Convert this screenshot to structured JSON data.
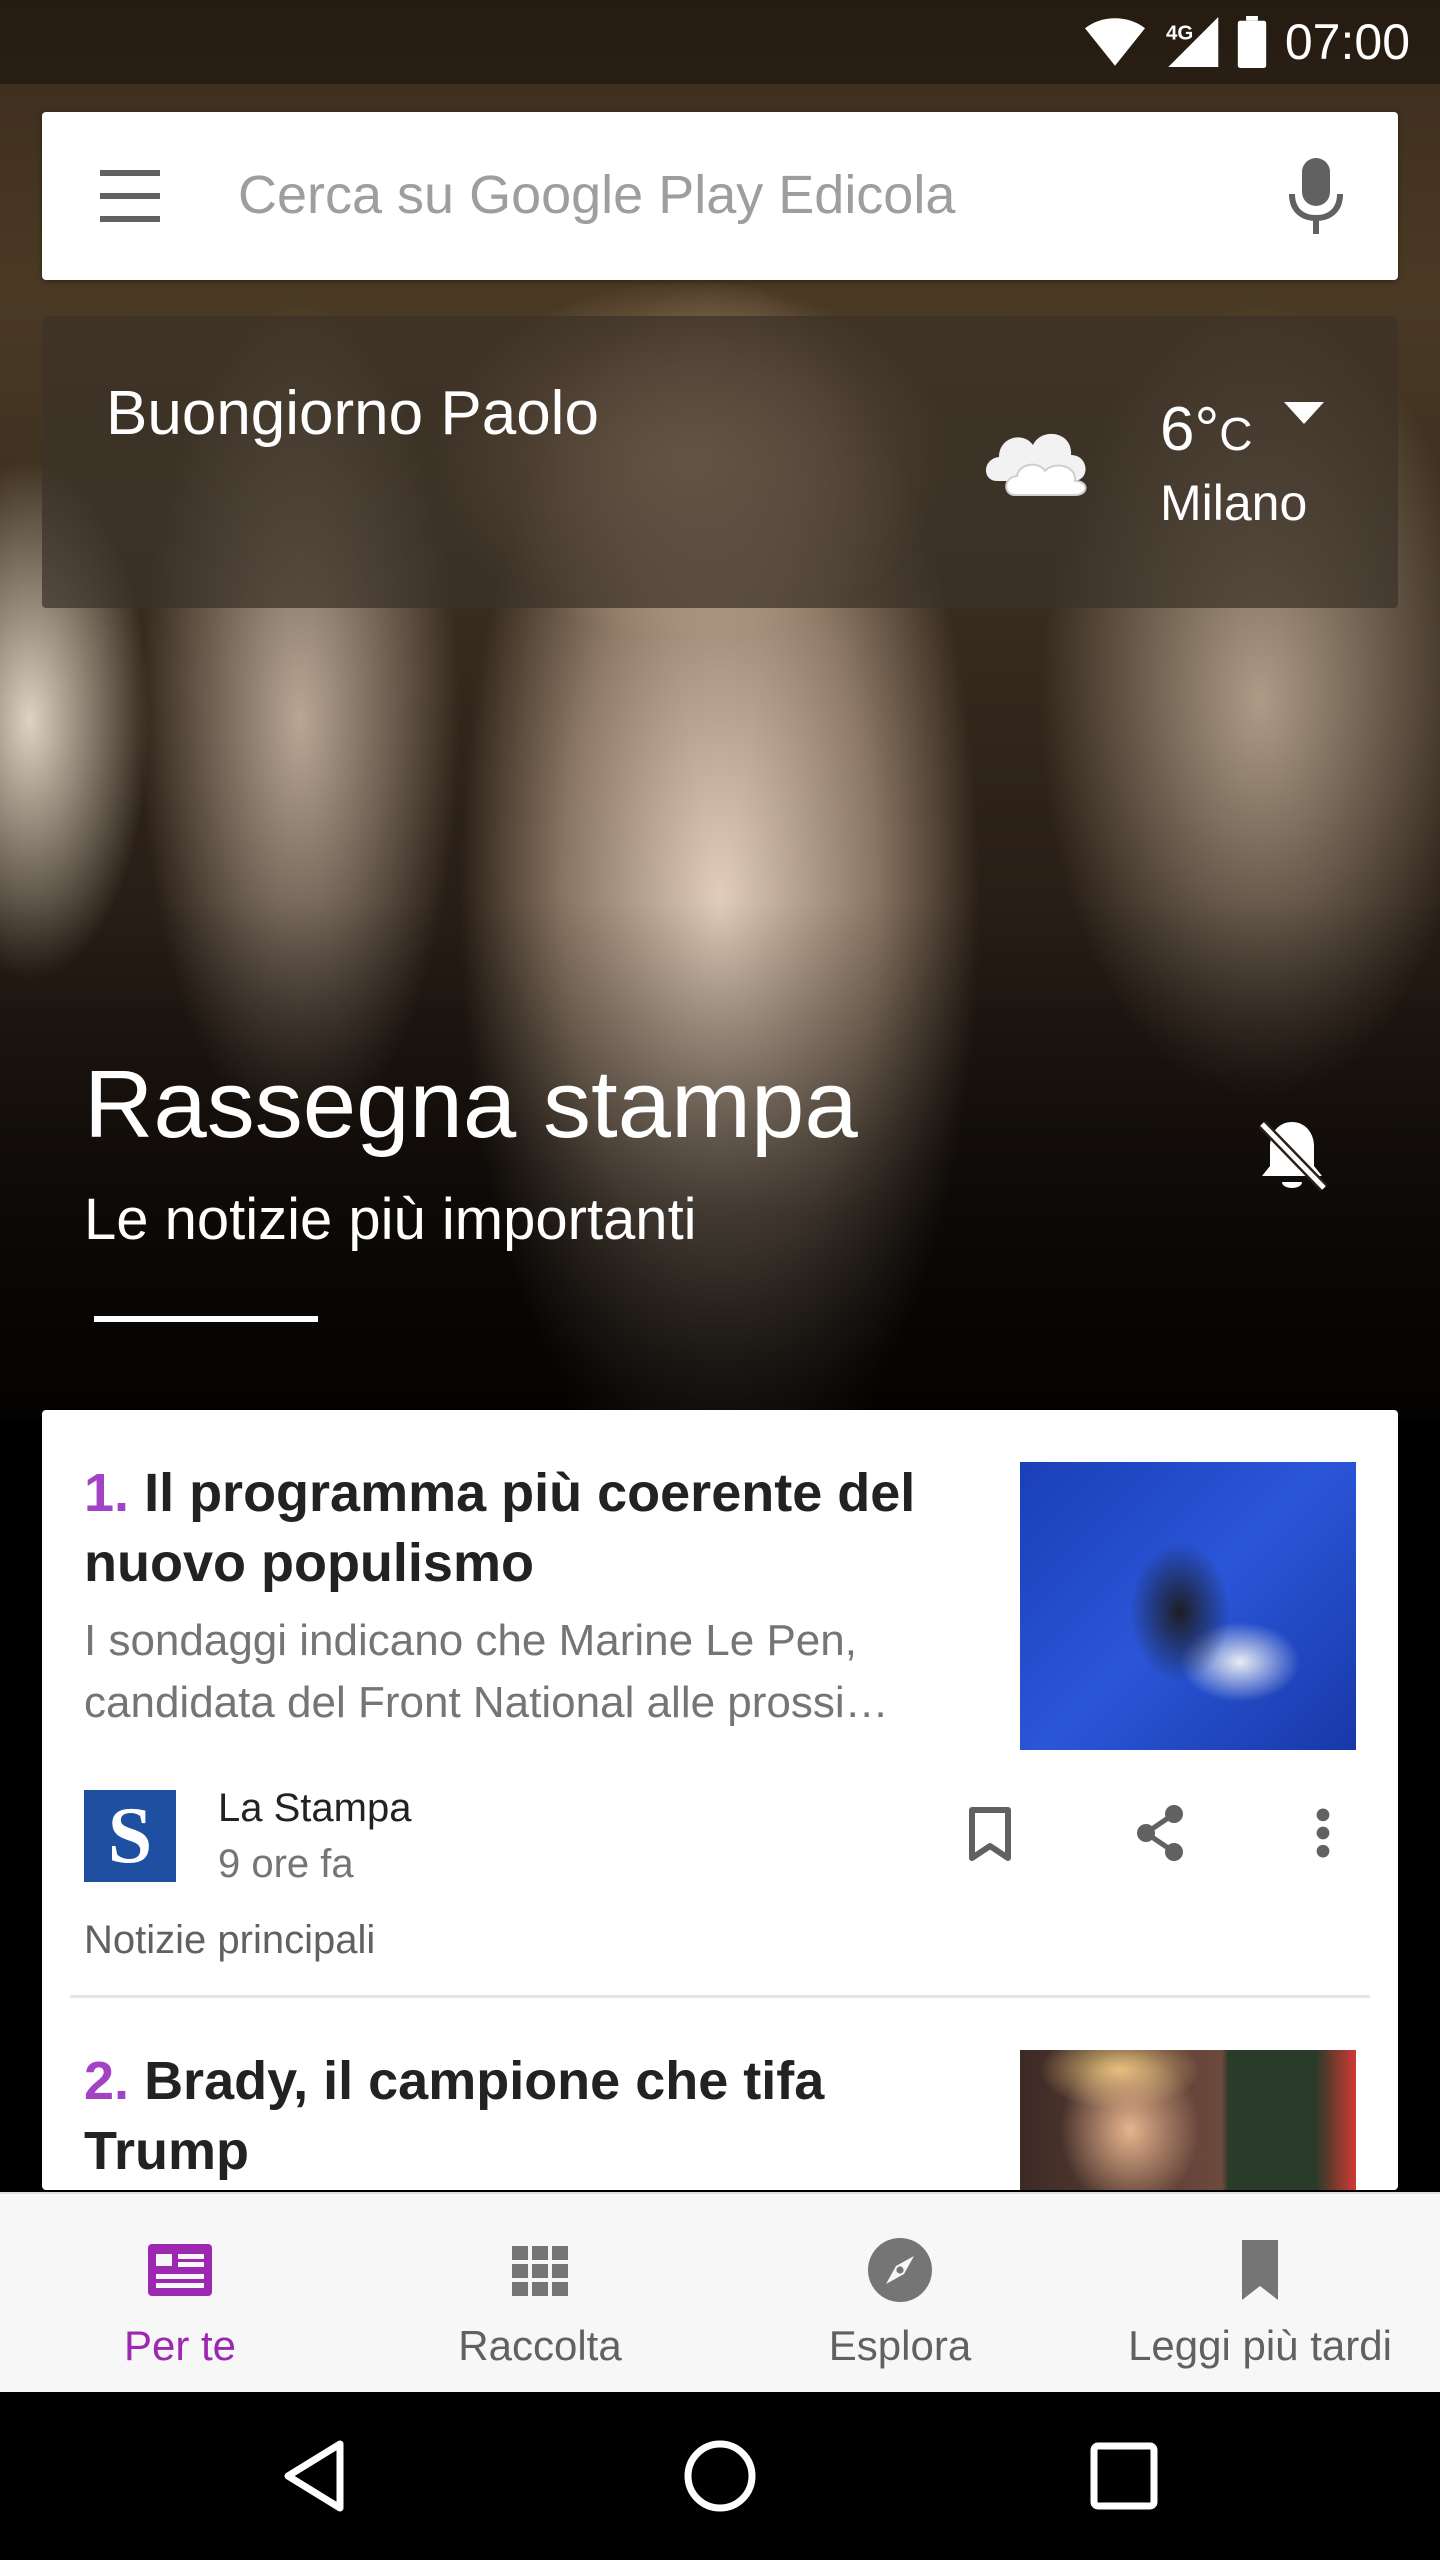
{
  "status_bar": {
    "network": "4G",
    "time": "07:00"
  },
  "search": {
    "placeholder": "Cerca su Google Play Edicola",
    "menu_icon": "menu-icon",
    "mic_icon": "mic-icon"
  },
  "greeting": {
    "text": "Buongiorno Paolo",
    "weather_icon": "cloud-icon",
    "temperature": "6°",
    "unit": "C",
    "city": "Milano"
  },
  "hero": {
    "title": "Rassegna stampa",
    "subtitle": "Le notizie più importanti",
    "notification_icon": "notifications-off-icon"
  },
  "stories": [
    {
      "number": "1.",
      "title": "Il programma più coerente del nuovo populismo",
      "snippet": "I sondaggi indicano che Marine Le Pen, candidata del Front National alle prossi…",
      "publisher_logo": "S",
      "publisher": "La Stampa",
      "time": "9 ore fa",
      "category": "Notizie principali"
    },
    {
      "number": "2.",
      "title": "Brady, il campione che tifa Trump"
    }
  ],
  "bottom_nav": [
    {
      "label": "Per te",
      "icon": "for-you-icon",
      "active": true
    },
    {
      "label": "Raccolta",
      "icon": "library-grid-icon",
      "active": false
    },
    {
      "label": "Esplora",
      "icon": "compass-icon",
      "active": false
    },
    {
      "label": "Leggi più tardi",
      "icon": "bookmark-icon",
      "active": false
    }
  ],
  "colors": {
    "accent": "#9c27b0",
    "story_number": "#a342c5",
    "card_background": "#ffffff",
    "nav_background": "#f7f7f7"
  }
}
